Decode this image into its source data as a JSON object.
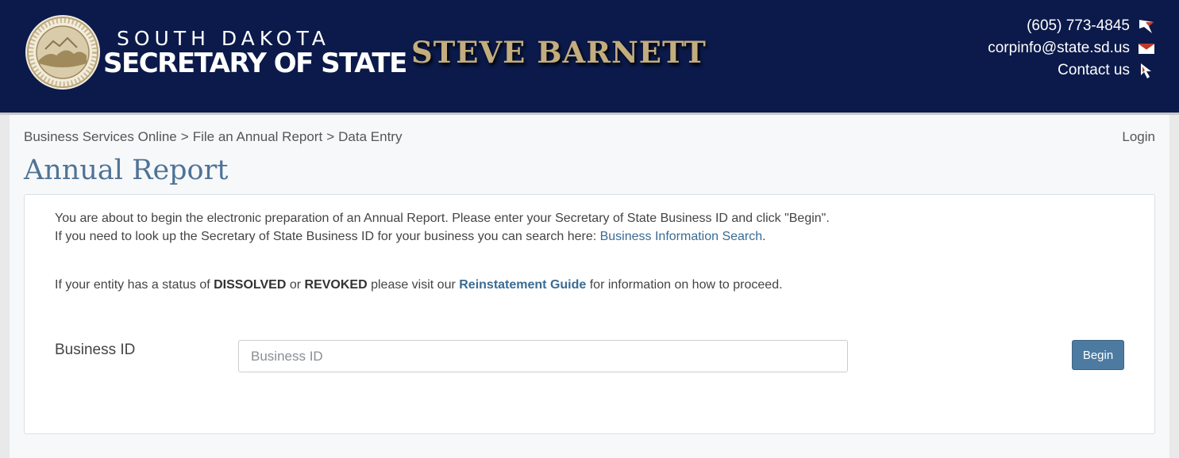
{
  "header": {
    "brand_line1": "SOUTH DAKOTA",
    "brand_line2": "SECRETARY OF STATE",
    "official_name": "STEVE BARNETT",
    "contact": {
      "phone": "(605) 773-4845",
      "email": "corpinfo@state.sd.us",
      "contact_us": "Contact us"
    },
    "colors": {
      "background": "#0b1a4a",
      "official_name": "#c3ad7e"
    },
    "icons": {
      "seal": "state-seal-icon",
      "phone": "phone-icon",
      "email": "envelope-icon",
      "contact": "cursor-icon"
    }
  },
  "breadcrumb": {
    "items": [
      "Business Services Online",
      "File an Annual Report",
      "Data Entry"
    ],
    "separator": ">"
  },
  "login_label": "Login",
  "page_title": "Annual Report",
  "intro": {
    "line1": "You are about to begin the electronic preparation of an Annual Report. Please enter your Secretary of State Business ID and click \"Begin\".",
    "line2_prefix": "If you need to look up the Secretary of State Business ID for your business you can search here: ",
    "line2_link": "Business Information Search",
    "line2_suffix": "."
  },
  "status_note": {
    "prefix": "If your entity has a status of ",
    "status1": "DISSOLVED",
    "middle": " or ",
    "status2": "REVOKED",
    "before_link": " please visit our ",
    "link": "Reinstatement Guide",
    "suffix": " for information on how to proceed."
  },
  "form": {
    "business_id_label": "Business ID",
    "business_id_value": "",
    "business_id_placeholder": "Business ID",
    "begin_label": "Begin"
  },
  "colors": {
    "title": "#4f7396",
    "link": "#3a6b93",
    "button": "#4c7aa0"
  }
}
